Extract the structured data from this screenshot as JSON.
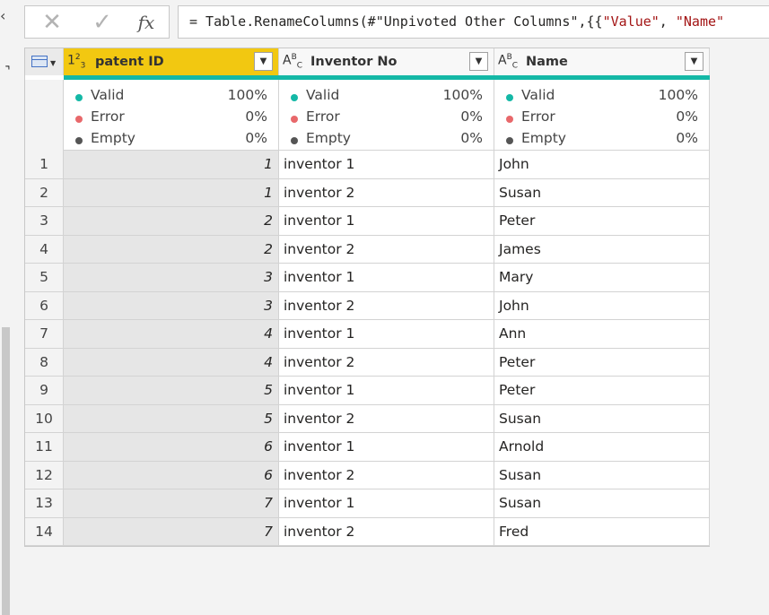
{
  "formula_bar": {
    "cancel_icon": "✕",
    "commit_icon": "✓",
    "fx_label": "fx",
    "formula_prefix": "= Table.RenameColumns(#\"Unpivoted Other Columns\",{{",
    "formula_str1": "\"Value\"",
    "formula_sep": ", ",
    "formula_str2": "\"Name\""
  },
  "columns": [
    {
      "type_label": "123",
      "name": "patent ID",
      "selected": true
    },
    {
      "type_label": "ABC",
      "name": "Inventor No",
      "selected": false
    },
    {
      "type_label": "ABC",
      "name": "Name",
      "selected": false
    }
  ],
  "quality": [
    {
      "valid": "Valid",
      "valid_pct": "100%",
      "error": "Error",
      "error_pct": "0%",
      "empty": "Empty",
      "empty_pct": "0%"
    },
    {
      "valid": "Valid",
      "valid_pct": "100%",
      "error": "Error",
      "error_pct": "0%",
      "empty": "Empty",
      "empty_pct": "0%"
    },
    {
      "valid": "Valid",
      "valid_pct": "100%",
      "error": "Error",
      "error_pct": "0%",
      "empty": "Empty",
      "empty_pct": "0%"
    }
  ],
  "colors": {
    "valid": "#14b8a6",
    "error": "#e8686b",
    "empty": "#555555",
    "selected_header": "#f2c811"
  },
  "rows": [
    {
      "n": "1",
      "patent_id": "1",
      "inventor_no": "inventor 1",
      "name": "John"
    },
    {
      "n": "2",
      "patent_id": "1",
      "inventor_no": "inventor 2",
      "name": "Susan"
    },
    {
      "n": "3",
      "patent_id": "2",
      "inventor_no": "inventor 1",
      "name": "Peter"
    },
    {
      "n": "4",
      "patent_id": "2",
      "inventor_no": "inventor 2",
      "name": "James"
    },
    {
      "n": "5",
      "patent_id": "3",
      "inventor_no": "inventor 1",
      "name": "Mary"
    },
    {
      "n": "6",
      "patent_id": "3",
      "inventor_no": "inventor 2",
      "name": "John"
    },
    {
      "n": "7",
      "patent_id": "4",
      "inventor_no": "inventor 1",
      "name": "Ann"
    },
    {
      "n": "8",
      "patent_id": "4",
      "inventor_no": "inventor 2",
      "name": "Peter"
    },
    {
      "n": "9",
      "patent_id": "5",
      "inventor_no": "inventor 1",
      "name": "Peter"
    },
    {
      "n": "10",
      "patent_id": "5",
      "inventor_no": "inventor 2",
      "name": "Susan"
    },
    {
      "n": "11",
      "patent_id": "6",
      "inventor_no": "inventor 1",
      "name": "Arnold"
    },
    {
      "n": "12",
      "patent_id": "6",
      "inventor_no": "inventor 2",
      "name": "Susan"
    },
    {
      "n": "13",
      "patent_id": "7",
      "inventor_no": "inventor 1",
      "name": "Susan"
    },
    {
      "n": "14",
      "patent_id": "7",
      "inventor_no": "inventor 2",
      "name": "Fred"
    }
  ]
}
